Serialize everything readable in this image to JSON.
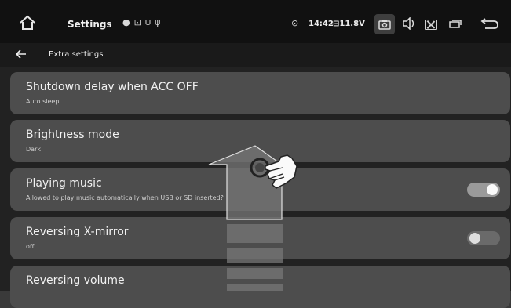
{
  "statusbar": {
    "title": "Settings",
    "time": "14:42",
    "battery": "11.8V",
    "icons": [
      "home-icon",
      "location-icon",
      "sd-card-icon",
      "usb-icon",
      "usb-icon",
      "location-pin-icon",
      "battery-icon",
      "screenshot-icon",
      "volume-icon",
      "close-window-icon",
      "recent-apps-icon",
      "back-icon"
    ]
  },
  "subbar": {
    "title": "Extra settings"
  },
  "settings": [
    {
      "title": "Shutdown delay when ACC OFF",
      "subtitle": "Auto sleep"
    },
    {
      "title": "Brightness mode",
      "subtitle": "Dark"
    },
    {
      "title": "Playing music",
      "subtitle": "Allowed to play music automatically when USB or SD inserted?",
      "toggle": "on"
    },
    {
      "title": "Reversing X-mirror",
      "subtitle": "off",
      "toggle": "off"
    },
    {
      "title": "Reversing volume",
      "subtitle": ""
    }
  ],
  "colors": {
    "statusbar_bg": "#111111",
    "card_bg": "#4d4d4d",
    "content_bg": "#222222"
  }
}
